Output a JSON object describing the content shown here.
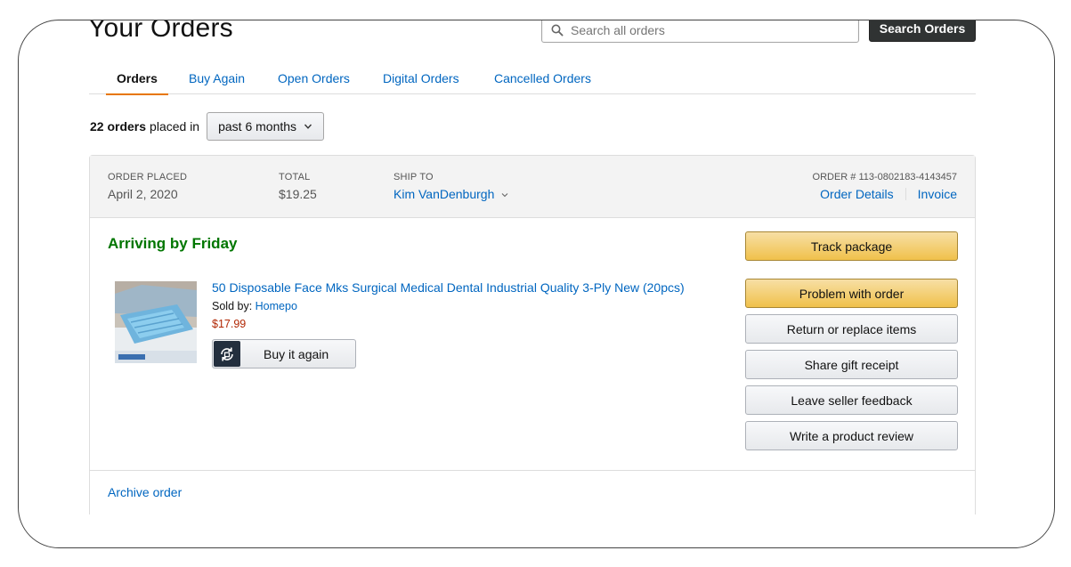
{
  "page": {
    "title": "Your Orders"
  },
  "search": {
    "placeholder": "Search all orders",
    "button_label": "Search Orders"
  },
  "tabs": [
    {
      "label": "Orders",
      "active": true
    },
    {
      "label": "Buy Again",
      "active": false
    },
    {
      "label": "Open Orders",
      "active": false
    },
    {
      "label": "Digital Orders",
      "active": false
    },
    {
      "label": "Cancelled Orders",
      "active": false
    }
  ],
  "filter": {
    "count_label": "22 orders",
    "placed_in_label": "placed in",
    "period": "past 6 months"
  },
  "order": {
    "header": {
      "placed_label": "ORDER PLACED",
      "placed_value": "April 2, 2020",
      "total_label": "TOTAL",
      "total_value": "$19.25",
      "ship_to_label": "SHIP TO",
      "ship_to_value": "Kim VanDenburgh",
      "order_number": "ORDER # 113-0802183-4143457",
      "details_link": "Order Details",
      "invoice_link": "Invoice"
    },
    "status": "Arriving by Friday",
    "item": {
      "title": "50 Disposable Face Mks Surgical Medical Dental Industrial Quality 3-Ply New (20pcs)",
      "sold_by_label": "Sold by:",
      "seller": "Homepo",
      "price": "$17.99",
      "buy_again_label": "Buy it again",
      "image_icon": "face-mask-product-image"
    },
    "actions": [
      {
        "label": "Track package",
        "style": "primary"
      },
      {
        "label": "Problem with order",
        "style": "primary"
      },
      {
        "label": "Return or replace items",
        "style": "secondary"
      },
      {
        "label": "Share gift receipt",
        "style": "secondary"
      },
      {
        "label": "Leave seller feedback",
        "style": "secondary"
      },
      {
        "label": "Write a product review",
        "style": "secondary"
      }
    ],
    "archive_label": "Archive order"
  },
  "colors": {
    "link": "#0066c0",
    "status_green": "#007600",
    "price_red": "#b12704",
    "tab_underline": "#e77600",
    "primary_button": "#f0c14b",
    "search_button": "#303333"
  }
}
